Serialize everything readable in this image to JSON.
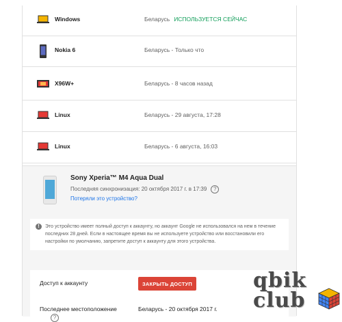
{
  "devices": [
    {
      "name": "Windows",
      "location": "Беларусь",
      "status": "ИСПОЛЬЗУЕТСЯ СЕЙЧАС",
      "icon": "laptop-icon",
      "color": "#f4b400"
    },
    {
      "name": "Nokia 6",
      "location": "Беларусь - Только что",
      "icon": "phone-icon"
    },
    {
      "name": "X96W+",
      "location": "Беларусь - 8 часов назад",
      "icon": "tv-box-icon"
    },
    {
      "name": "Linux",
      "location": "Беларусь - 29 августа, 17:28",
      "icon": "laptop-icon"
    },
    {
      "name": "Linux",
      "location": "Беларусь - 6 августа, 16:03",
      "icon": "laptop-icon"
    }
  ],
  "expanded": {
    "title": "Sony Xperia™ M4 Aqua Dual",
    "sync": "Последняя синхронизация: 20 октября 2017 г. в 17:39",
    "lost_link": "Потеряли это устройство?",
    "info": "Это устройство имеет полный доступ к аккаунту, но аккаунт Google не использовался на нем в течение последних 28 дней. Если в настоящее время вы не используете устройство или восстановили его настройки по умолчанию, запретите доступ к аккаунту для этого устройства.",
    "access_label": "Доступ к аккаунту",
    "revoke_label": "ЗАКРЫТЬ ДОСТУП",
    "last_location_label": "Последнее местоположение",
    "last_location_value": "Беларусь - 20 октября 2017 г."
  },
  "watermark": {
    "line1": "qbik",
    "line2": "club"
  },
  "colors": {
    "active": "#0f9d58",
    "revoke": "#db4437",
    "link": "#1a73e8"
  }
}
